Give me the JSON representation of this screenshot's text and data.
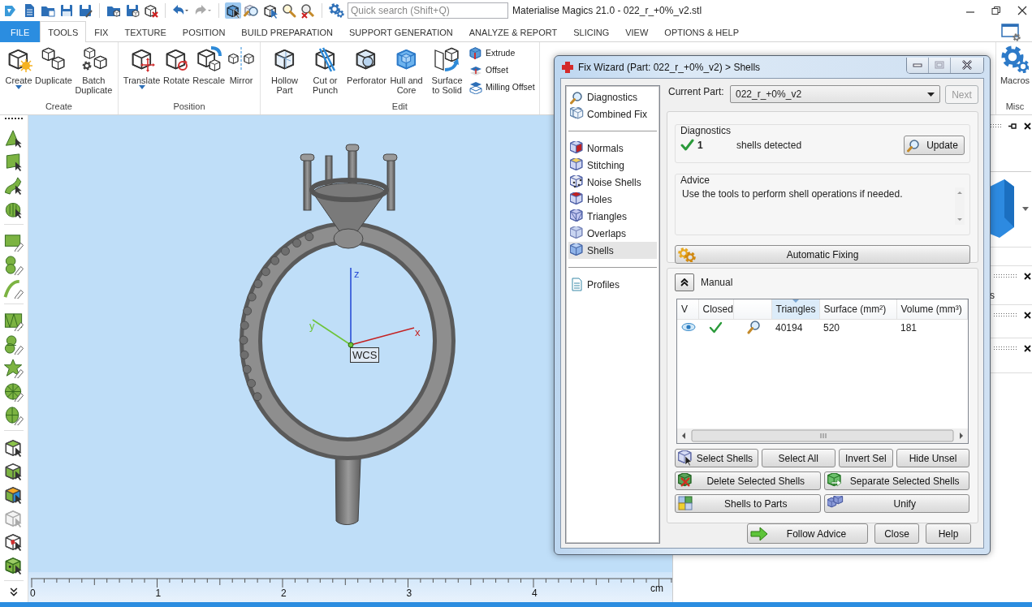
{
  "window": {
    "title": "Materialise Magics 21.0 - 022_r_+0%_v2.stl"
  },
  "search": {
    "placeholder": "Quick search (Shift+Q)"
  },
  "ribbon_tabs": [
    {
      "label": "FILE",
      "kind": "menu",
      "selected": false
    },
    {
      "label": "TOOLS",
      "kind": "tab",
      "selected": true
    },
    {
      "label": "FIX",
      "kind": "tab",
      "selected": false
    },
    {
      "label": "TEXTURE",
      "kind": "tab",
      "selected": false
    },
    {
      "label": "POSITION",
      "kind": "tab",
      "selected": false
    },
    {
      "label": "BUILD PREPARATION",
      "kind": "tab",
      "selected": false
    },
    {
      "label": "SUPPORT GENERATION",
      "kind": "tab",
      "selected": false
    },
    {
      "label": "ANALYZE & REPORT",
      "kind": "tab",
      "selected": false
    },
    {
      "label": "SLICING",
      "kind": "tab",
      "selected": false
    },
    {
      "label": "VIEW",
      "kind": "tab",
      "selected": false
    },
    {
      "label": "OPTIONS & HELP",
      "kind": "tab",
      "selected": false
    }
  ],
  "ribbon_groups": [
    {
      "title": "Create",
      "items": [
        {
          "label": "Create",
          "dropdown": true
        },
        {
          "label": "Duplicate",
          "dropdown": false
        },
        {
          "label": "Batch Duplicate",
          "dropdown": false
        }
      ]
    },
    {
      "title": "Position",
      "items": [
        {
          "label": "Translate",
          "dropdown": true
        },
        {
          "label": "Rotate",
          "dropdown": false
        },
        {
          "label": "Rescale",
          "dropdown": false
        },
        {
          "label": "Mirror",
          "dropdown": false
        }
      ]
    },
    {
      "title": "Edit",
      "items": [
        {
          "label": "Hollow Part",
          "dropdown": false
        },
        {
          "label": "Cut or Punch",
          "dropdown": false
        },
        {
          "label": "Perforator",
          "dropdown": false
        },
        {
          "label": "Hull and Core",
          "dropdown": false
        },
        {
          "label": "Surface to Solid",
          "dropdown": false
        }
      ],
      "small_items": [
        {
          "label": "Extrude"
        },
        {
          "label": "Offset"
        },
        {
          "label": "Milling Offset"
        }
      ]
    },
    {
      "title": "Misc",
      "items": [
        {
          "label": "Macros",
          "dropdown": false
        }
      ]
    }
  ],
  "viewport": {
    "axes": [
      {
        "kind": "z",
        "label": "z"
      },
      {
        "kind": "y",
        "label": "y"
      },
      {
        "kind": "x",
        "label": "x"
      }
    ],
    "origin_label": "WCS"
  },
  "ruler": {
    "ticks": [
      "0",
      "1",
      "2",
      "3",
      "4"
    ],
    "unit": "cm"
  },
  "side_panel": {
    "fragment": "s"
  },
  "dialog": {
    "title": "Fix Wizard (Part: 022_r_+0%_v2) > Shells",
    "nav_groups": [
      {
        "items": [
          {
            "label": "Diagnostics",
            "kind": "diagnostics",
            "selected": false
          },
          {
            "label": "Combined Fix",
            "kind": "combined",
            "selected": false
          }
        ]
      },
      {
        "items": [
          {
            "label": "Normals",
            "kind": "normals",
            "selected": false
          },
          {
            "label": "Stitching",
            "kind": "stitching",
            "selected": false
          },
          {
            "label": "Noise Shells",
            "kind": "noise",
            "selected": false
          },
          {
            "label": "Holes",
            "kind": "holes",
            "selected": false
          },
          {
            "label": "Triangles",
            "kind": "triangles",
            "selected": false
          },
          {
            "label": "Overlaps",
            "kind": "overlaps",
            "selected": false
          },
          {
            "label": "Shells",
            "kind": "shells",
            "selected": true
          }
        ]
      },
      {
        "items": [
          {
            "label": "Profiles",
            "kind": "profiles",
            "selected": false
          }
        ]
      }
    ],
    "current_part": {
      "label": "Current Part:",
      "value": "022_r_+0%_v2"
    },
    "next_button": {
      "label": "Next",
      "disabled": true
    },
    "diagnostics": {
      "title": "Diagnostics",
      "ok": true,
      "count": "1",
      "text": "shells detected",
      "button": "Update"
    },
    "advice": {
      "title": "Advice",
      "text": "Use the tools to perform shell operations if needed."
    },
    "auto_fix_button": "Automatic Fixing",
    "manual": {
      "title": "Manual",
      "expanded": true,
      "columns": [
        {
          "label": "V",
          "sorted": false
        },
        {
          "label": "Closed",
          "sorted": false
        },
        {
          "label": "Triangles",
          "sorted": true
        },
        {
          "label": "Surface (mm²)",
          "sorted": false
        },
        {
          "label": "Volume (mm³)",
          "sorted": false
        }
      ],
      "rows": [
        {
          "visible": true,
          "closed": true,
          "triangles": "40194",
          "surface": "520",
          "volume": "181"
        }
      ],
      "button_rows": [
        [
          {
            "label": "Select Shells",
            "kind": "select"
          },
          {
            "label": "Select All",
            "kind": "plain"
          },
          {
            "label": "Invert Sel",
            "kind": "plain"
          },
          {
            "label": "Hide Unsel",
            "kind": "plain"
          }
        ],
        [
          {
            "label": "Delete Selected Shells",
            "kind": "delete"
          },
          {
            "label": "Separate Selected Shells",
            "kind": "separate"
          }
        ],
        [
          {
            "label": "Shells to Parts",
            "kind": "parts"
          },
          {
            "label": "Unify",
            "kind": "unify"
          }
        ]
      ]
    },
    "footer_buttons": [
      {
        "label": "Follow Advice",
        "kind": "arrow"
      },
      {
        "label": "Close",
        "kind": "plain"
      },
      {
        "label": "Help",
        "kind": "plain"
      }
    ]
  }
}
